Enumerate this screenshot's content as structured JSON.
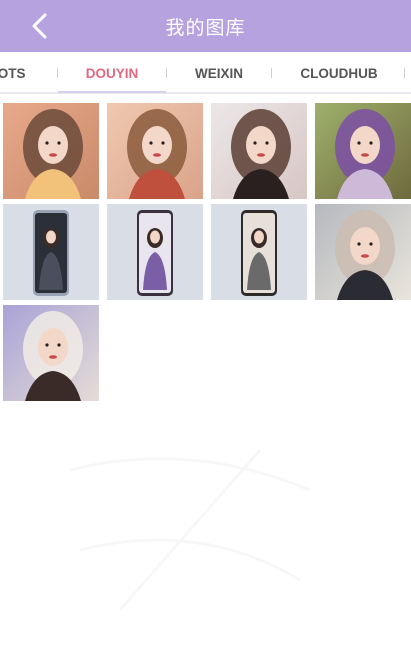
{
  "header": {
    "title": "我的图库",
    "back_icon": "chevron-left-icon",
    "background": "#b7a2e0"
  },
  "tabs": [
    {
      "label": "HOTS",
      "shown": "IOTS",
      "active": false
    },
    {
      "label": "DOUYIN",
      "shown": "DOUYIN",
      "active": true
    },
    {
      "label": "WEIXIN",
      "shown": "WEIXIN",
      "active": false
    },
    {
      "label": "CLOUDHUB",
      "shown": "CLOUDHUB",
      "active": false
    }
  ],
  "colors": {
    "active_tab": "#e2677f",
    "inactive_tab": "#555555",
    "underline": "#d5d0ec"
  },
  "gallery": {
    "items": [
      {
        "kind": "photo",
        "palette": [
          "#e8a98a",
          "#c98a6a",
          "#f2c27b",
          "#6b4a3a"
        ]
      },
      {
        "kind": "photo",
        "palette": [
          "#f0c9b0",
          "#d9a38a",
          "#c0503e",
          "#8a5b3b"
        ]
      },
      {
        "kind": "photo",
        "palette": [
          "#ece7e8",
          "#d7c6c4",
          "#2a2020",
          "#5a3d33"
        ]
      },
      {
        "kind": "photo",
        "palette": [
          "#9fb06c",
          "#6e6a3e",
          "#cfb9d8",
          "#7b4fa6"
        ]
      },
      {
        "kind": "phone",
        "palette": [
          "#d8dde6",
          "#4a4f5e",
          "#2b2f38",
          "#9aa3b5"
        ]
      },
      {
        "kind": "phone",
        "palette": [
          "#d8dde6",
          "#7a5ea6",
          "#e8e5ef",
          "#3a3040"
        ]
      },
      {
        "kind": "phone",
        "palette": [
          "#d8dde6",
          "#6a6a6a",
          "#e6e0d8",
          "#2e2a28"
        ]
      },
      {
        "kind": "photo",
        "palette": [
          "#b5b8be",
          "#e9e5dc",
          "#2b2b33",
          "#cbbcb0"
        ]
      },
      {
        "kind": "photo",
        "palette": [
          "#a9a2d6",
          "#e4ddd6",
          "#3a2a28",
          "#f1ece6"
        ]
      }
    ]
  }
}
